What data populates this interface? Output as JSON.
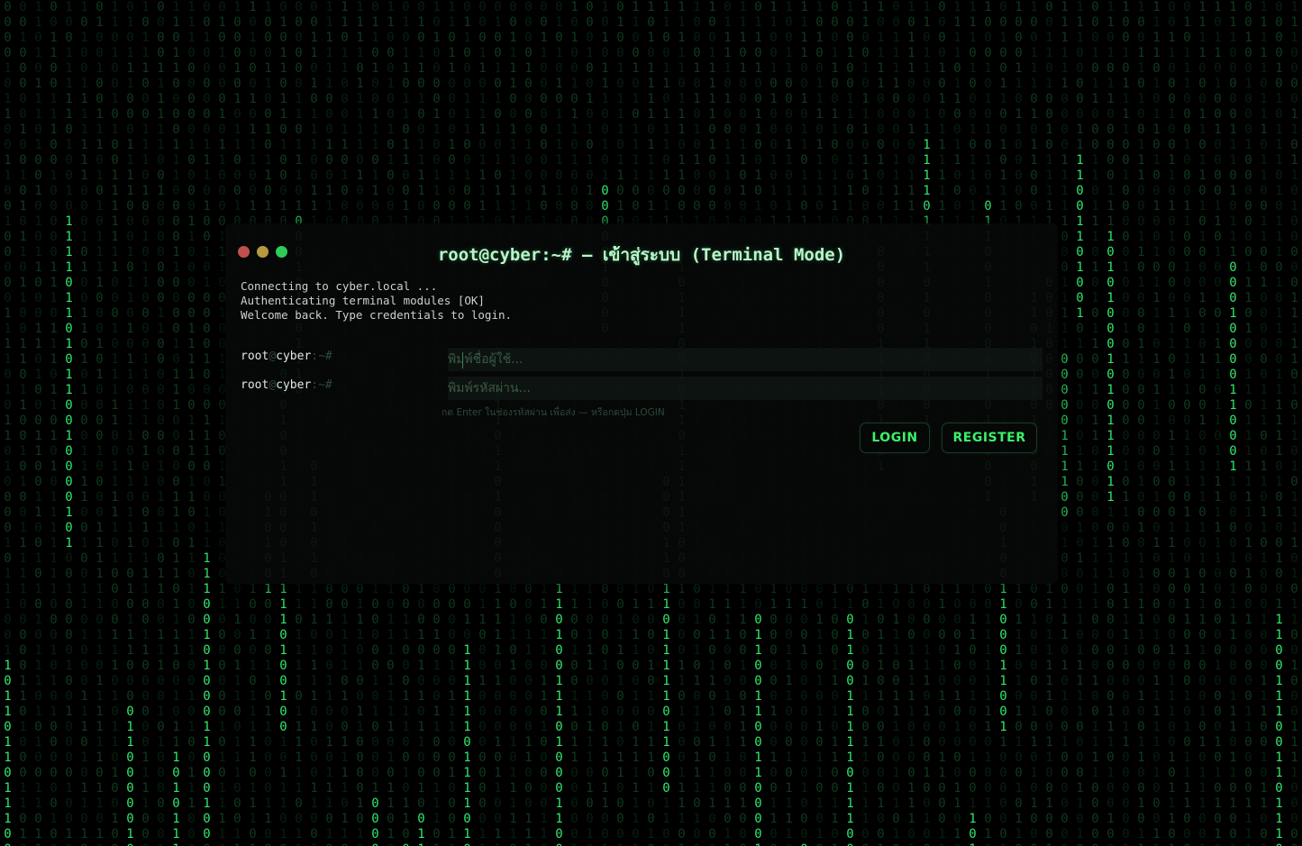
{
  "background": {
    "glyphs": [
      "0",
      "1"
    ],
    "colors": {
      "bright": "#2ee86a",
      "dim": "#0f3a1e",
      "faint": "#07200f"
    }
  },
  "terminal": {
    "title": "root@cyber:~# — เข้าสู่ระบบ (Terminal Mode)",
    "window_dots": [
      "close-dot",
      "minimize-dot",
      "maximize-dot"
    ],
    "boot_lines": [
      "Connecting to cyber.local ...",
      "Authenticating terminal modules [OK]",
      "Welcome back. Type credentials to login."
    ],
    "prompt": {
      "user": "root",
      "at": "@",
      "host": "cyber",
      "sep": ":~#"
    },
    "username_placeholder": "พิมพ์ชื่อผู้ใช้...",
    "password_placeholder": "พิมพ์รหัสผ่าน...",
    "hint": "กด Enter ในช่องรหัสผ่าน เพื่อส่ง — หรือกดปุ่ม LOGIN",
    "login_label": "LOGIN",
    "register_label": "REGISTER"
  },
  "colors": {
    "accent": "#3cf06a",
    "panel": "#060807",
    "title": "#b8f5c8"
  }
}
